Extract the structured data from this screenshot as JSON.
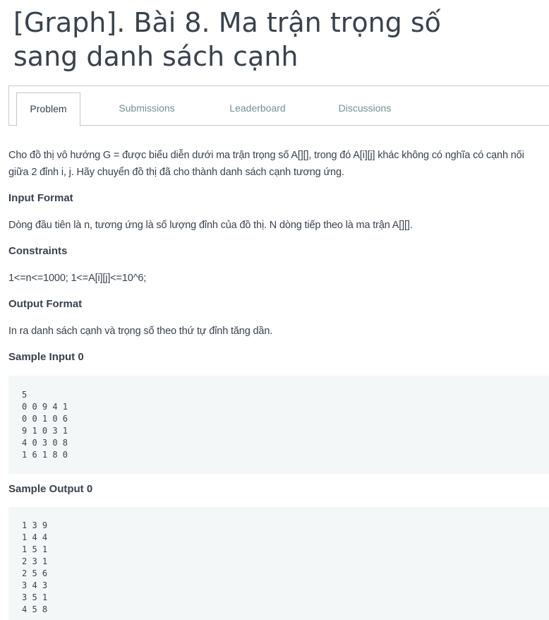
{
  "title": "[Graph]. Bài 8. Ma trận trọng số sang danh sách cạnh",
  "tabs": [
    {
      "label": "Problem",
      "active": true
    },
    {
      "label": "Submissions",
      "active": false
    },
    {
      "label": "Leaderboard",
      "active": false
    },
    {
      "label": "Discussions",
      "active": false
    }
  ],
  "problem": {
    "statement": "Cho đồ thị vô hướng G = được biểu diễn dưới ma trận trọng số A[][], trong đó A[i][j] khác không có nghĩa có cạnh nối giữa 2 đỉnh i, j. Hãy chuyển đồ thị đã cho thành danh sách cạnh tương ứng.",
    "input_format_heading": "Input Format",
    "input_format": "Dòng đầu tiên là n, tương ứng là số lượng đỉnh của đồ thị. N dòng tiếp theo là ma trận A[][].",
    "constraints_heading": "Constraints",
    "constraints": "1<=n<=1000; 1<=A[i][j]<=10^6;",
    "output_format_heading": "Output Format",
    "output_format": "In ra danh sách cạnh và trọng số theo thứ tự đỉnh tăng dần.",
    "sample_input_heading": "Sample Input 0",
    "sample_input": "5\n0 0 9 4 1\n0 0 1 0 6\n9 1 0 3 1\n4 0 3 0 8\n1 6 1 8 0",
    "sample_output_heading": "Sample Output 0",
    "sample_output": "1 3 9\n1 4 4\n1 5 1\n2 3 1\n2 5 6\n3 4 3\n3 5 1\n4 5 8"
  }
}
